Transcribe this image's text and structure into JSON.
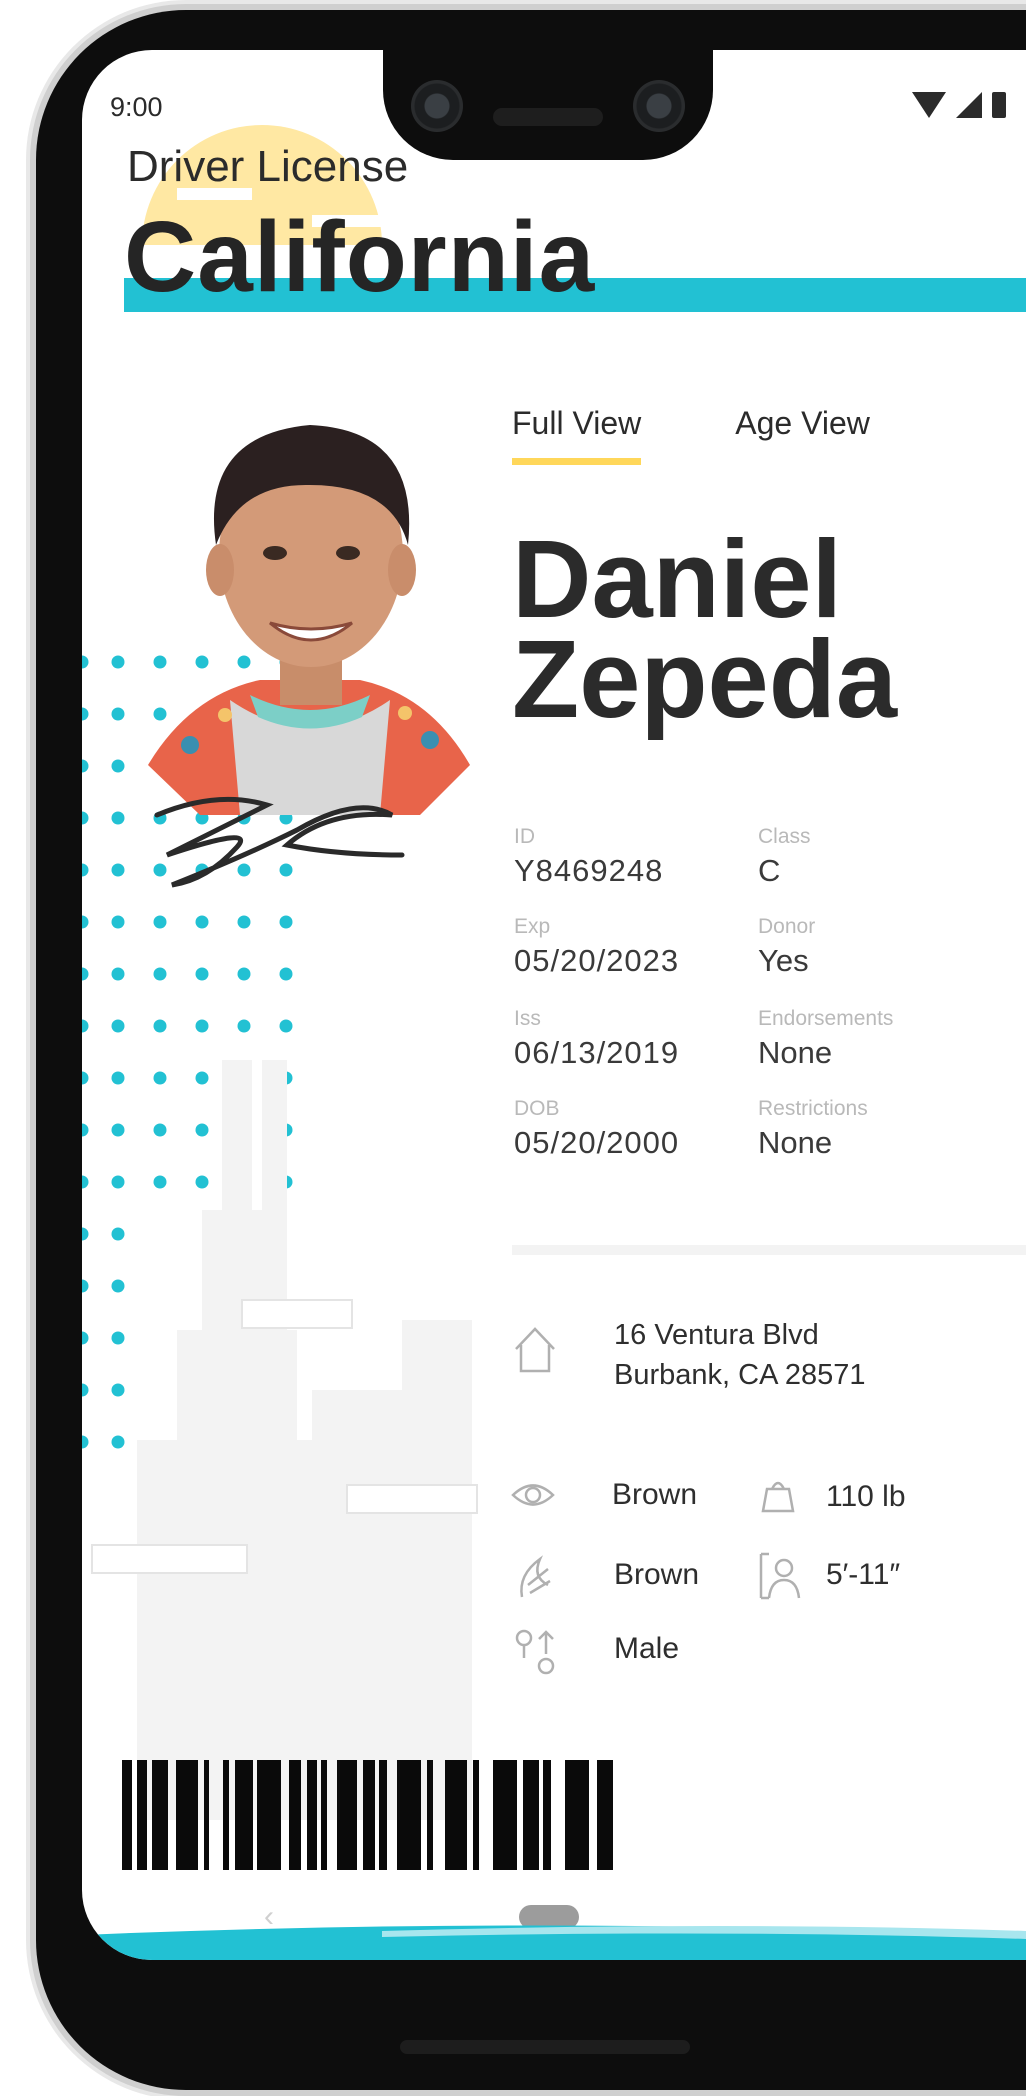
{
  "status_bar": {
    "time": "9:00"
  },
  "card": {
    "subtitle": "Driver License",
    "state": "California"
  },
  "tabs": [
    {
      "label": "Full View",
      "active": true
    },
    {
      "label": "Age View",
      "active": false
    }
  ],
  "holder": {
    "first_name": "Daniel",
    "last_name": "Zepeda"
  },
  "fields": [
    {
      "label": "ID",
      "value": "Y8469248"
    },
    {
      "label": "Class",
      "value": "C"
    },
    {
      "label": "Exp",
      "value": "05/20/2023"
    },
    {
      "label": "Donor",
      "value": "Yes"
    },
    {
      "label": "Iss",
      "value": "06/13/2019"
    },
    {
      "label": "Endorsements",
      "value": "None"
    },
    {
      "label": "DOB",
      "value": "05/20/2000"
    },
    {
      "label": "Restrictions",
      "value": "None"
    }
  ],
  "address": {
    "line1": "16 Ventura Blvd",
    "line2": "Burbank, CA 28571"
  },
  "attributes": {
    "eyes": "Brown",
    "weight": "110 lb",
    "hair": "Brown",
    "height": "5′-11″",
    "sex": "Male"
  },
  "icons": {
    "address": "house-icon",
    "eyes": "eye-icon",
    "weight": "weight-icon",
    "hair": "hair-icon",
    "height": "height-icon",
    "sex": "gender-icon"
  },
  "colors": {
    "accent": "#22c1d3",
    "tab_underline": "#ffd75a",
    "sun": "#ffe8a3"
  },
  "nav": {
    "back": "‹"
  }
}
